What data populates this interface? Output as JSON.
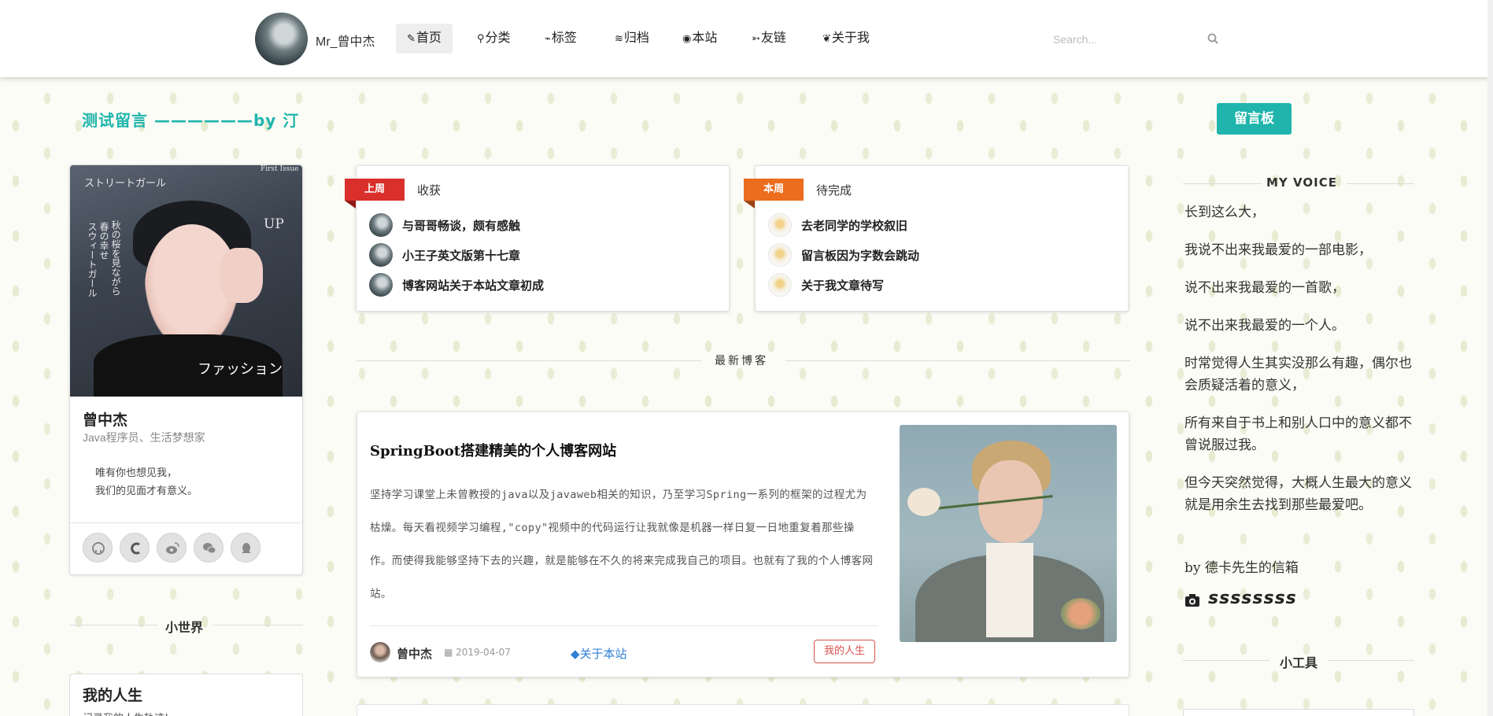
{
  "nav": {
    "brand": "Mr_曾中杰",
    "items": [
      {
        "icon": "✎",
        "label": "首页",
        "active": true
      },
      {
        "icon": "⚲",
        "label": "分类",
        "active": false
      },
      {
        "icon": "⌁",
        "label": "标签",
        "active": false
      },
      {
        "icon": "≋",
        "label": "归档",
        "active": false
      },
      {
        "icon": "◉",
        "label": "本站",
        "active": false
      },
      {
        "icon": "➳",
        "label": "友链",
        "active": false
      },
      {
        "icon": "❦",
        "label": "关于我",
        "active": false
      }
    ],
    "search_placeholder": "Search..."
  },
  "marquee": "测试留言 ——————by  汀",
  "board_button": "留言板",
  "profile": {
    "photo_text": {
      "top": "ストリートガール",
      "issue": "First Issue",
      "up": "UP",
      "bottom": "ファッション",
      "vertical_1": "秋の桜を見ながら",
      "vertical_2": "春の幸せ",
      "vertical_3": "スウィートガール"
    },
    "name": "曾中杰",
    "role": "Java程序员、生活梦想家",
    "quote_1": "唯有你也想见我，",
    "quote_2": "我们的见面才有意义。",
    "social": [
      "github-icon",
      "csdn-icon",
      "weibo-icon",
      "wechat-icon",
      "qq-icon"
    ]
  },
  "small_world_title": "小世界",
  "life_card": {
    "title": "我的人生",
    "subtitle": "记录我的人生轨迹!"
  },
  "weeks": [
    {
      "tag": "上周",
      "category": "收获",
      "items": [
        "与哥哥畅谈，颇有感触",
        "小王子英文版第十七章",
        "博客网站关于本站文章初成"
      ]
    },
    {
      "tag": "本周",
      "category": "待完成",
      "items": [
        "去老同学的学校叙旧",
        "留言板因为字数会跳动",
        "关于我文章待写"
      ]
    }
  ],
  "latest_title": "最新博客",
  "post": {
    "title": "SpringBoot搭建精美的个人博客网站",
    "excerpt": "坚持学习课堂上未曾教授的java以及javaweb相关的知识，乃至学习Spring一系列的框架的过程尤为枯燥。每天看视频学习编程,\"copy\"视频中的代码运行让我就像是机器一样日复一日地重复着那些操作。而使得我能够坚持下去的兴趣，就是能够在不久的将来完成我自己的项目。也就有了我的个人博客网站。",
    "author": "曾中杰",
    "date": "2019-04-07",
    "category": "关于本站",
    "tag": "我的人生"
  },
  "voice": {
    "title": "MY VOICE",
    "paragraphs": [
      "长到这么大，",
      "我说不出来我最爱的一部电影，",
      "说不出来我最爱的一首歌，",
      "说不出来我最爱的一个人。",
      "时常觉得人生其实没那么有趣，偶尔也会质疑活着的意义，",
      "所有来自于书上和别人口中的意义都不曾说服过我。",
      "但今天突然觉得，大概人生最大的意义就是用余生去找到那些最爱吧。"
    ],
    "signature": "by 德卡先生的信箱",
    "squiggle": "ssssssss"
  },
  "tools_title": "小工具",
  "colors": {
    "accent": "#1fb5ac",
    "red_tag": "#d9302c",
    "orange_tag": "#ec6d1e",
    "link": "#2f7fd6"
  }
}
